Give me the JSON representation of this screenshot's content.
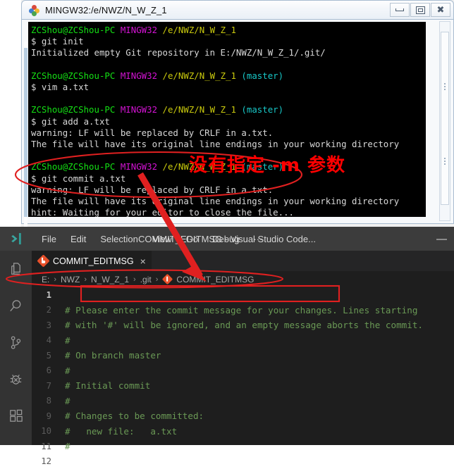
{
  "terminal": {
    "title": "MINGW32:/e/NWZ/N_W_Z_1",
    "icon": "mingw-git-icon",
    "window_buttons": {
      "minimize": "minimize-icon",
      "maximize": "maximize-icon",
      "close": "close-icon"
    },
    "prompt": {
      "user_host": "ZCShou@ZCShou-PC",
      "shell": "MINGW32",
      "path": "/e/NWZ/N_W_Z_1",
      "branch": "(master)",
      "sigil": "$"
    },
    "colors": {
      "user_host": "#14e014",
      "shell": "#d413d4",
      "path": "#c9c90d",
      "branch": "#18c7c7",
      "output": "#d8d8d8",
      "background": "#000000"
    },
    "blocks": [
      {
        "prompt_has_branch": false,
        "command": "$ git init",
        "output": [
          "Initialized empty Git repository in E:/NWZ/N_W_Z_1/.git/"
        ]
      },
      {
        "prompt_has_branch": true,
        "command": "$ vim a.txt",
        "output": []
      },
      {
        "prompt_has_branch": true,
        "command": "$ git add a.txt",
        "output": [
          "warning: LF will be replaced by CRLF in a.txt.",
          "The file will have its original line endings in your working directory"
        ]
      },
      {
        "prompt_has_branch": true,
        "command": "$ git commit a.txt",
        "output": [
          "warning: LF will be replaced by CRLF in a.txt.",
          "The file will have its original line endings in your working directory",
          "hint: Waiting for your editor to close the file..."
        ]
      }
    ]
  },
  "annotations": {
    "note_text": "没有指定 -m 参数",
    "note_color": "#ff0000",
    "ellipse_terminal": "red-ellipse-around-commit-block",
    "ellipse_breadcrumb": "red-ellipse-around-breadcrumb",
    "rect_line1": "red-rect-around-empty-line-1",
    "arrow": "red-arrow-terminal-to-breadcrumb"
  },
  "vscode": {
    "window_title": "COMMIT_EDITMSG - Visual Studio Code...",
    "logo": "vscode-logo-icon",
    "minimize_label": "—",
    "menu": [
      {
        "label": "File"
      },
      {
        "label": "Edit"
      },
      {
        "label": "Selection"
      },
      {
        "label": "View"
      },
      {
        "label": "Go"
      },
      {
        "label": "Debug"
      },
      {
        "label": "···"
      }
    ],
    "activity_bar": [
      {
        "name": "explorer-icon"
      },
      {
        "name": "search-icon"
      },
      {
        "name": "source-control-icon"
      },
      {
        "name": "debug-icon"
      },
      {
        "name": "extensions-icon"
      }
    ],
    "tab": {
      "label": "COMMIT_EDITMSG",
      "icon": "git-file-icon",
      "close": "×"
    },
    "breadcrumb": [
      {
        "label": "E:"
      },
      {
        "label": "NWZ"
      },
      {
        "label": "N_W_Z_1"
      },
      {
        "label": ".git"
      },
      {
        "label": "COMMIT_EDITMSG",
        "icon": "git-file-icon"
      }
    ],
    "breadcrumb_separator": "›",
    "editor": {
      "lines": [
        {
          "no": "1",
          "text": "",
          "active": true
        },
        {
          "no": "2",
          "text": "# Please enter the commit message for your changes. Lines starting",
          "active": false
        },
        {
          "no": "3",
          "text": "# with '#' will be ignored, and an empty message aborts the commit.",
          "active": false
        },
        {
          "no": "4",
          "text": "#",
          "active": false
        },
        {
          "no": "5",
          "text": "# On branch master",
          "active": false
        },
        {
          "no": "6",
          "text": "#",
          "active": false
        },
        {
          "no": "7",
          "text": "# Initial commit",
          "active": false
        },
        {
          "no": "8",
          "text": "#",
          "active": false
        },
        {
          "no": "9",
          "text": "# Changes to be committed:",
          "active": false
        },
        {
          "no": "10",
          "text": "#\tnew file:   a.txt",
          "active": false
        },
        {
          "no": "11",
          "text": "#",
          "active": false
        },
        {
          "no": "12",
          "text": "",
          "active": false
        }
      ],
      "comment_color": "#6a9955",
      "background": "#1e1e1e"
    }
  }
}
